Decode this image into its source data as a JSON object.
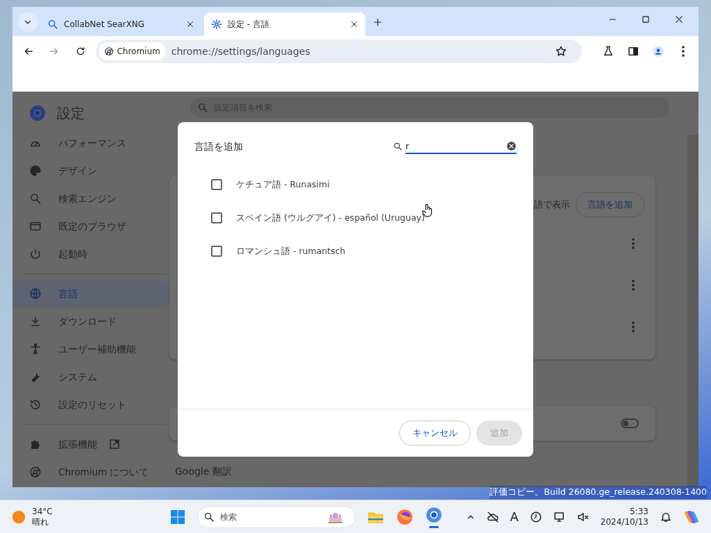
{
  "tabs": [
    {
      "title": "CollabNet SearXNG",
      "selected": false
    },
    {
      "title": "設定 - 言語",
      "selected": true
    }
  ],
  "toolbar": {
    "site_chip": "Chromium",
    "url": "chrome://settings/languages"
  },
  "settings": {
    "title": "設定",
    "search_placeholder": "設定項目を検索",
    "sidebar": [
      {
        "items": [
          {
            "label": "パフォーマンス",
            "selected": false
          },
          {
            "label": "デザイン",
            "selected": false
          },
          {
            "label": "検索エンジン",
            "selected": false
          },
          {
            "label": "既定のブラウザ",
            "selected": false
          },
          {
            "label": "起動時",
            "selected": false
          }
        ]
      },
      {
        "items": [
          {
            "label": "言語",
            "selected": true
          },
          {
            "label": "ダウンロード",
            "selected": false
          },
          {
            "label": "ユーザー補助機能",
            "selected": false
          },
          {
            "label": "システム",
            "selected": false
          },
          {
            "label": "設定のリセット",
            "selected": false
          }
        ]
      },
      {
        "items": [
          {
            "label": "拡張機能",
            "selected": false,
            "external": true
          },
          {
            "label": "Chromium について",
            "selected": false,
            "external": false
          }
        ]
      }
    ],
    "card_text": "語で表示",
    "add_language_button": "言語を追加",
    "toggle_on": false,
    "translate_heading": "Google 翻訳"
  },
  "dialog": {
    "title": "言語を追加",
    "search_value": "r",
    "languages": [
      {
        "label": "ケチュア語 - Runasimi",
        "checked": false
      },
      {
        "label": "スペイン語 (ウルグアイ) - español (Uruguay)",
        "checked": false
      },
      {
        "label": "ロマンシュ語 - rumantsch",
        "checked": false
      }
    ],
    "cancel_button": "キャンセル",
    "add_button": {
      "label": "追加",
      "disabled": true
    }
  },
  "desktop": {
    "watermark": "評価コピー。Build 26080.ge_release.240308-1400"
  },
  "taskbar": {
    "temperature": "34°C",
    "weather": "晴れ",
    "search_placeholder": "検索",
    "ime": "A",
    "time": "5:33",
    "date": "2024/10/13"
  }
}
